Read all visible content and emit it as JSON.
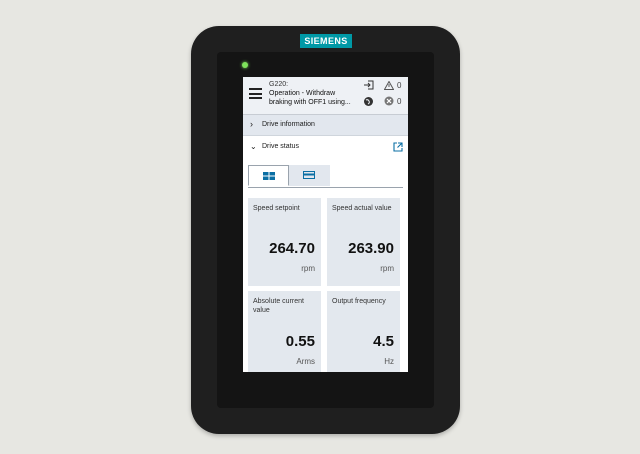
{
  "brand": "SIEMENS",
  "header": {
    "device_name": "G220:",
    "message": "Operation - Withdraw braking with OFF1 using...",
    "warning_count": "0",
    "error_count": "0"
  },
  "sections": {
    "drive_information": "Drive information",
    "drive_status": "Drive status"
  },
  "tabs": [
    "tiles-view",
    "list-view"
  ],
  "cards": [
    {
      "title": "Speed setpoint",
      "value": "264.70",
      "unit": "rpm"
    },
    {
      "title": "Speed actual value",
      "value": "263.90",
      "unit": "rpm"
    },
    {
      "title": "Absolute current value",
      "value": "0.55",
      "unit": "Arms"
    },
    {
      "title": "Output frequency",
      "value": "4.5",
      "unit": "Hz"
    }
  ],
  "colors": {
    "brand": "#0099a6",
    "led": "#7ee35b",
    "accent": "#0b6fa4",
    "card_bg": "#e3e8ee"
  }
}
